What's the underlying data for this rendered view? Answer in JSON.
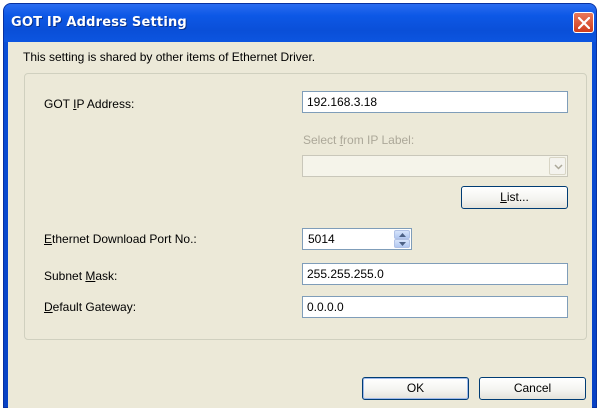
{
  "window": {
    "title": "GOT IP Address Setting",
    "close_icon": "close-icon"
  },
  "info_text": "This setting is shared by other items of Ethernet Driver.",
  "ip": {
    "label_pre": "GOT ",
    "label_accel": "I",
    "label_post": "P Address:",
    "value": "192.168.3.18"
  },
  "ip_label": {
    "label_pre": "Select ",
    "label_accel": "f",
    "label_post": "rom IP Label:",
    "combo_value": "",
    "list_button_accel": "L",
    "list_button_rest": "ist..."
  },
  "download_port": {
    "label_accel": "E",
    "label_post": "thernet Download Port No.:",
    "value": "5014"
  },
  "subnet": {
    "label_pre": "Subnet ",
    "label_accel": "M",
    "label_post": "ask:",
    "value": "255.255.255.0"
  },
  "gateway": {
    "label_accel": "D",
    "label_post": "efault Gateway:",
    "value": "0.0.0.0"
  },
  "buttons": {
    "ok": "OK",
    "cancel": "Cancel"
  },
  "colors": {
    "title_bar": "#0a4fd8",
    "client_bg": "#ece9d8",
    "close_button": "#cf3c1d",
    "disabled_text": "#aca899"
  }
}
